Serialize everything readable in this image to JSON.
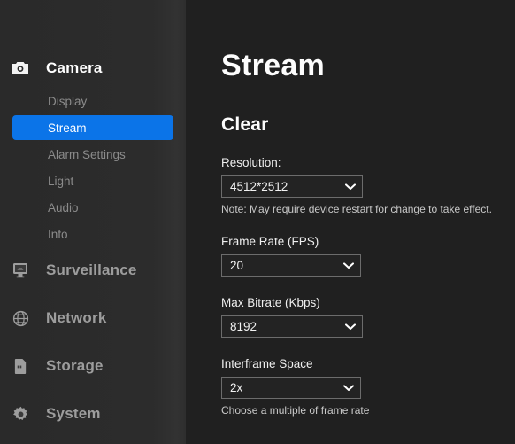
{
  "sidebar": {
    "groups": [
      {
        "label": "Camera",
        "icon": "camera-icon",
        "active": true,
        "items": [
          {
            "label": "Display",
            "active": false
          },
          {
            "label": "Stream",
            "active": true
          },
          {
            "label": "Alarm Settings",
            "active": false
          },
          {
            "label": "Light",
            "active": false
          },
          {
            "label": "Audio",
            "active": false
          },
          {
            "label": "Info",
            "active": false
          }
        ]
      },
      {
        "label": "Surveillance",
        "icon": "monitor-icon",
        "active": false,
        "items": []
      },
      {
        "label": "Network",
        "icon": "globe-icon",
        "active": false,
        "items": []
      },
      {
        "label": "Storage",
        "icon": "sdcard-icon",
        "active": false,
        "items": []
      },
      {
        "label": "System",
        "icon": "gear-icon",
        "active": false,
        "items": []
      }
    ]
  },
  "main": {
    "page_title": "Stream",
    "section_title": "Clear",
    "fields": {
      "resolution": {
        "label": "Resolution:",
        "value": "4512*2512",
        "note": "Note: May require device restart for change to take effect."
      },
      "frame_rate": {
        "label": "Frame Rate (FPS)",
        "value": "20",
        "note": ""
      },
      "max_bitrate": {
        "label": "Max Bitrate (Kbps)",
        "value": "8192",
        "note": ""
      },
      "interframe_space": {
        "label": "Interframe Space",
        "value": "2x",
        "note": "Choose a multiple of frame rate"
      }
    }
  },
  "colors": {
    "accent": "#0b74e8",
    "sidebar_bg": "#2c2c2c",
    "main_bg": "#202020",
    "text_primary": "#fdfdfd",
    "text_muted": "#8b8b8b",
    "select_border": "#6c6c6c"
  }
}
